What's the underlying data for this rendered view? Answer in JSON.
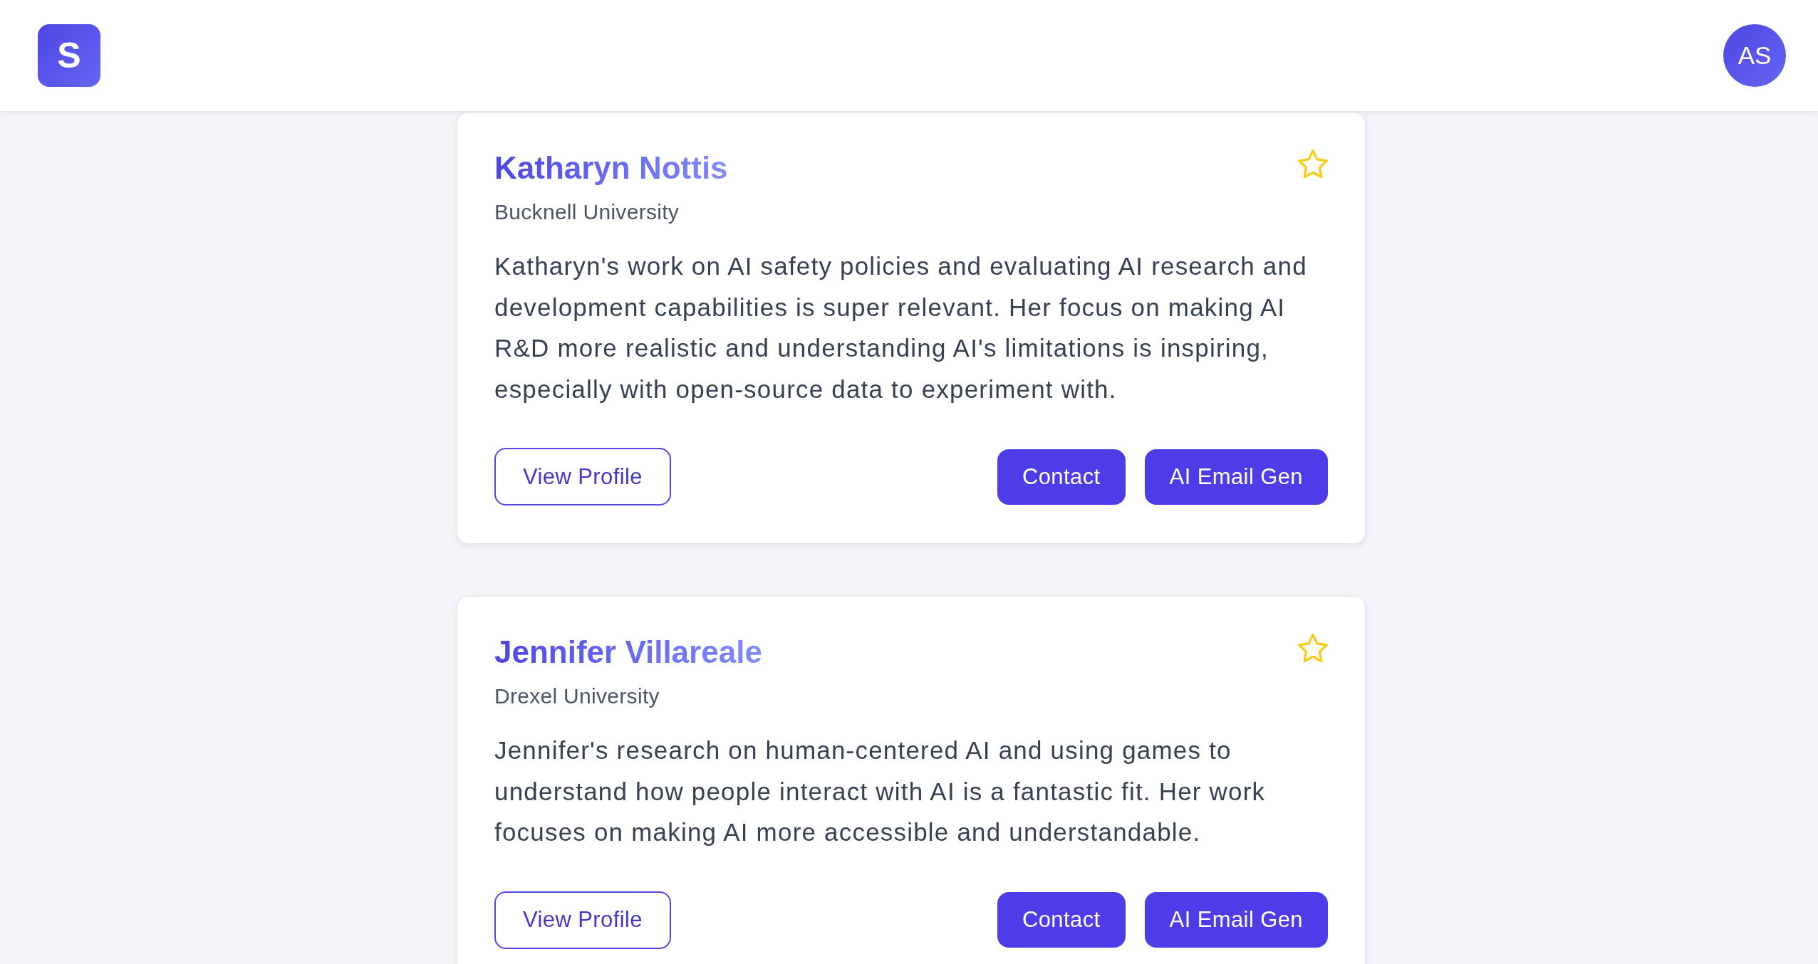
{
  "header": {
    "logo": "S",
    "avatar": "AS"
  },
  "cards": [
    {
      "name": "Katharyn Nottis",
      "university": "Bucknell University",
      "favorite": false,
      "description": "Katharyn's work on AI safety policies and evaluating AI research and development capabilities is super relevant. Her focus on making AI R&D more realistic and understanding AI's limitations is inspiring, especially with open-source data to experiment with.",
      "buttons": [
        {
          "label": "View Profile",
          "kind": "outline"
        },
        {
          "label": "Contact",
          "kind": "primary"
        },
        {
          "label": "AI Email Gen",
          "kind": "primary"
        }
      ]
    },
    {
      "name": "Jennifer Villareale",
      "university": "Drexel University",
      "favorite": false,
      "description": "Jennifer's research on human-centered AI and using games to understand how people interact with AI is a fantastic fit. Her work focuses on making AI more accessible and understandable.",
      "buttons": [
        {
          "label": "View Profile",
          "kind": "outline"
        },
        {
          "label": "Contact",
          "kind": "primary"
        },
        {
          "label": "AI Email Gen",
          "kind": "primary"
        }
      ]
    }
  ]
}
